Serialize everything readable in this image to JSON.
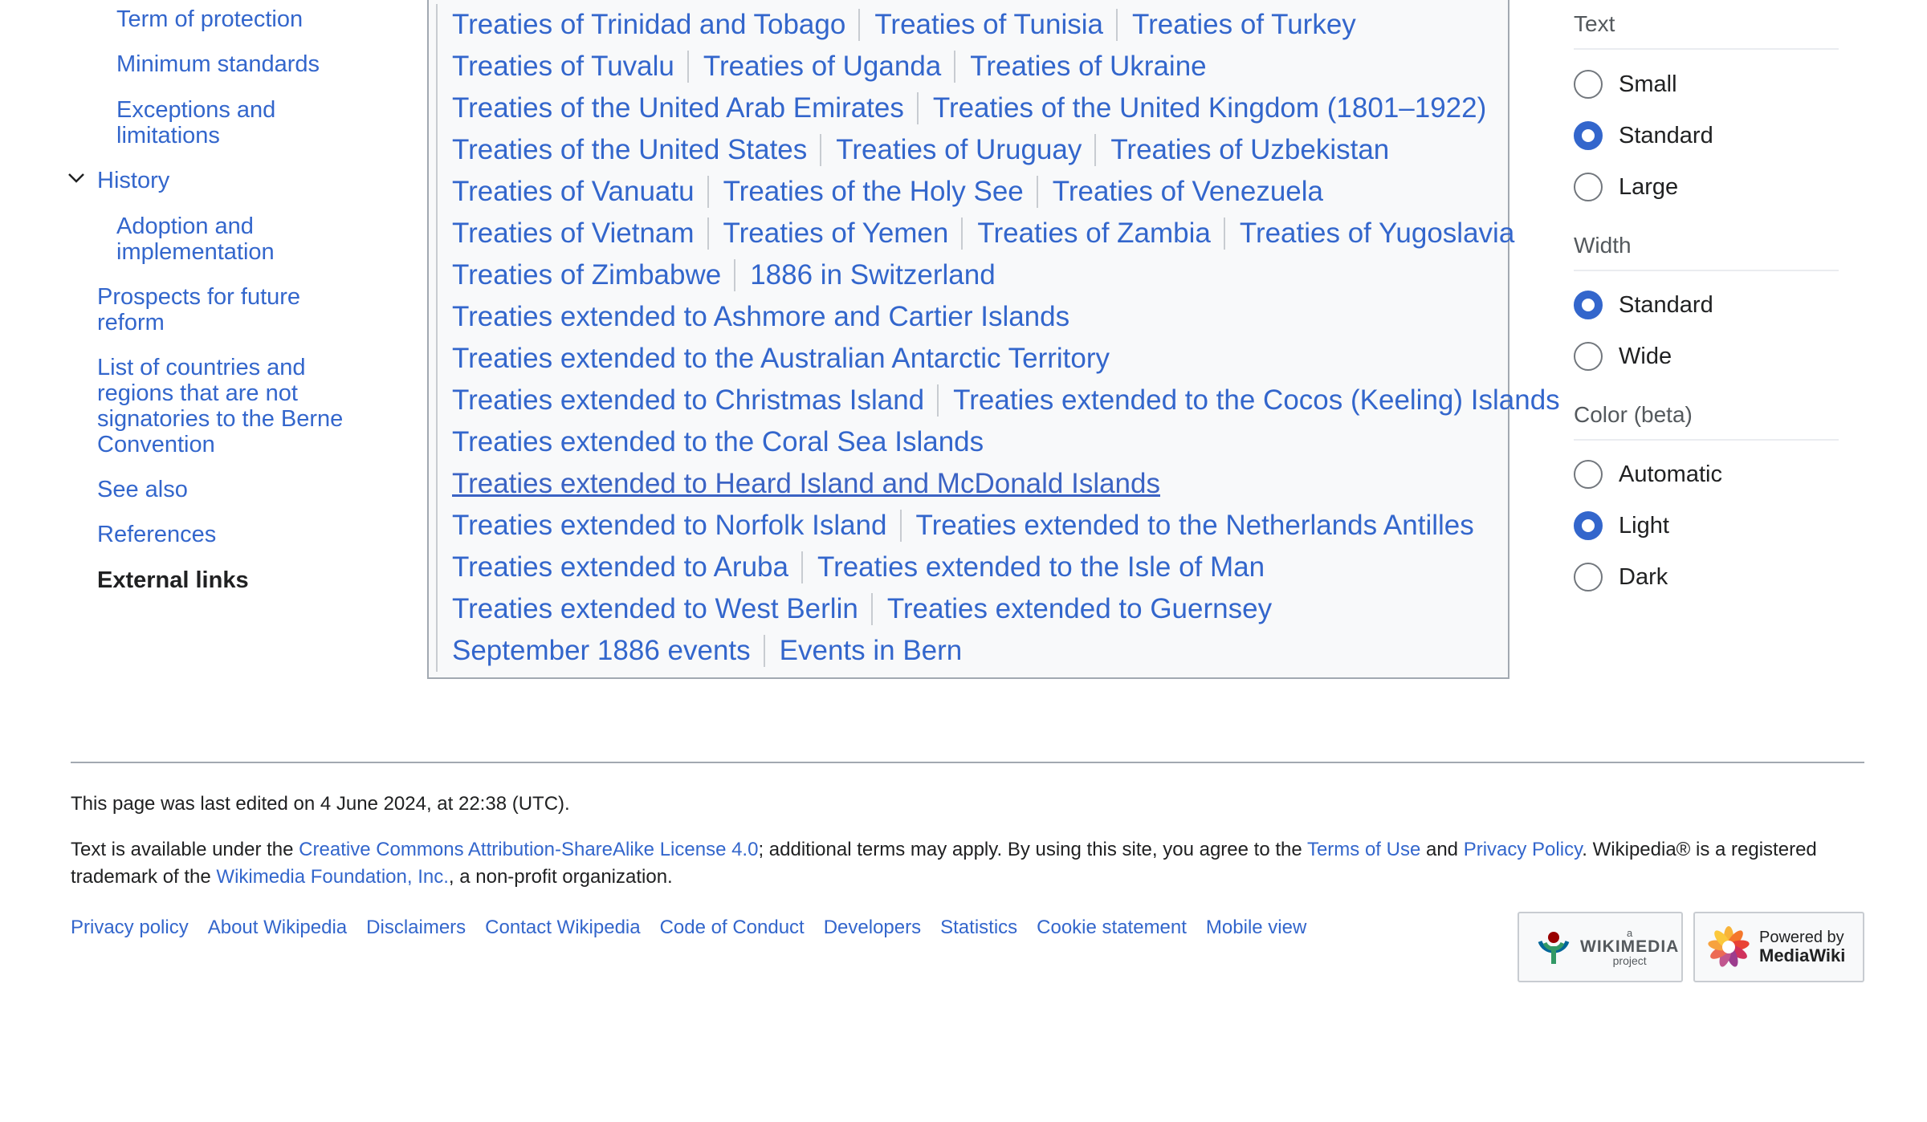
{
  "toc": {
    "items": [
      {
        "label": "Term of protection",
        "level": 2
      },
      {
        "label": "Minimum standards",
        "level": 2
      },
      {
        "label": "Exceptions and limitations",
        "level": 2
      },
      {
        "label": "History",
        "level": 1
      },
      {
        "label": "Adoption and implementation",
        "level": 2
      },
      {
        "label": "Prospects for future reform",
        "level": 1
      },
      {
        "label": "List of countries and regions that are not signatories to the Berne Convention",
        "level": 1
      },
      {
        "label": "See also",
        "level": 1
      },
      {
        "label": "References",
        "level": 1
      },
      {
        "label": "External links",
        "level": 1
      }
    ]
  },
  "navbox": {
    "rows": [
      [
        "Treaties of Trinidad and Tobago",
        "Treaties of Tunisia",
        "Treaties of Turkey"
      ],
      [
        "Treaties of Tuvalu",
        "Treaties of Uganda",
        "Treaties of Ukraine"
      ],
      [
        "Treaties of the United Arab Emirates",
        "Treaties of the United Kingdom (1801–1922)"
      ],
      [
        "Treaties of the United States",
        "Treaties of Uruguay",
        "Treaties of Uzbekistan"
      ],
      [
        "Treaties of Vanuatu",
        "Treaties of the Holy See",
        "Treaties of Venezuela"
      ],
      [
        "Treaties of Vietnam",
        "Treaties of Yemen",
        "Treaties of Zambia",
        "Treaties of Yugoslavia"
      ],
      [
        "Treaties of Zimbabwe",
        "1886 in Switzerland"
      ],
      [
        "Treaties extended to Ashmore and Cartier Islands"
      ],
      [
        "Treaties extended to the Australian Antarctic Territory"
      ],
      [
        "Treaties extended to Christmas Island",
        "Treaties extended to the Cocos (Keeling) Islands"
      ],
      [
        "Treaties extended to the Coral Sea Islands"
      ],
      [
        "Treaties extended to Heard Island and McDonald Islands"
      ],
      [
        "Treaties extended to Norfolk Island",
        "Treaties extended to the Netherlands Antilles"
      ],
      [
        "Treaties extended to Aruba",
        "Treaties extended to the Isle of Man"
      ],
      [
        "Treaties extended to West Berlin",
        "Treaties extended to Guernsey"
      ],
      [
        "September 1886 events",
        "Events in Bern"
      ]
    ]
  },
  "appearance": {
    "text_heading": "Text",
    "text_options": [
      "Small",
      "Standard",
      "Large"
    ],
    "text_selected": "Standard",
    "width_heading": "Width",
    "width_options": [
      "Standard",
      "Wide"
    ],
    "width_selected": "Standard",
    "color_heading": "Color (beta)",
    "color_options": [
      "Automatic",
      "Light",
      "Dark"
    ],
    "color_selected": "Light"
  },
  "footer": {
    "last_edited": "This page was last edited on 4 June 2024, at 22:38 (UTC).",
    "license_1": "Text is available under the ",
    "license_link": "Creative Commons Attribution-ShareAlike License 4.0",
    "license_2": "; additional terms may apply. By using this site, you agree to the ",
    "terms_link": "Terms of Use",
    "license_3": " and ",
    "privacy_link": "Privacy Policy",
    "license_4": ". Wikipedia® is a registered trademark of the ",
    "foundation_link": "Wikimedia Foundation, Inc.",
    "license_5": ", a non-profit organization.",
    "links": [
      "Privacy policy",
      "About Wikipedia",
      "Disclaimers",
      "Contact Wikipedia",
      "Code of Conduct",
      "Developers",
      "Statistics",
      "Cookie statement",
      "Mobile view"
    ],
    "wikimedia_badge": {
      "small": "a",
      "main": "WIKIMEDIA",
      "sub": "project"
    },
    "mediawiki_badge": {
      "line1": "Powered by",
      "line2": "MediaWiki"
    }
  },
  "colors": {
    "link": "#3366cc",
    "accent": "#3366cc",
    "text": "#202122",
    "border": "#a2a9b1"
  }
}
